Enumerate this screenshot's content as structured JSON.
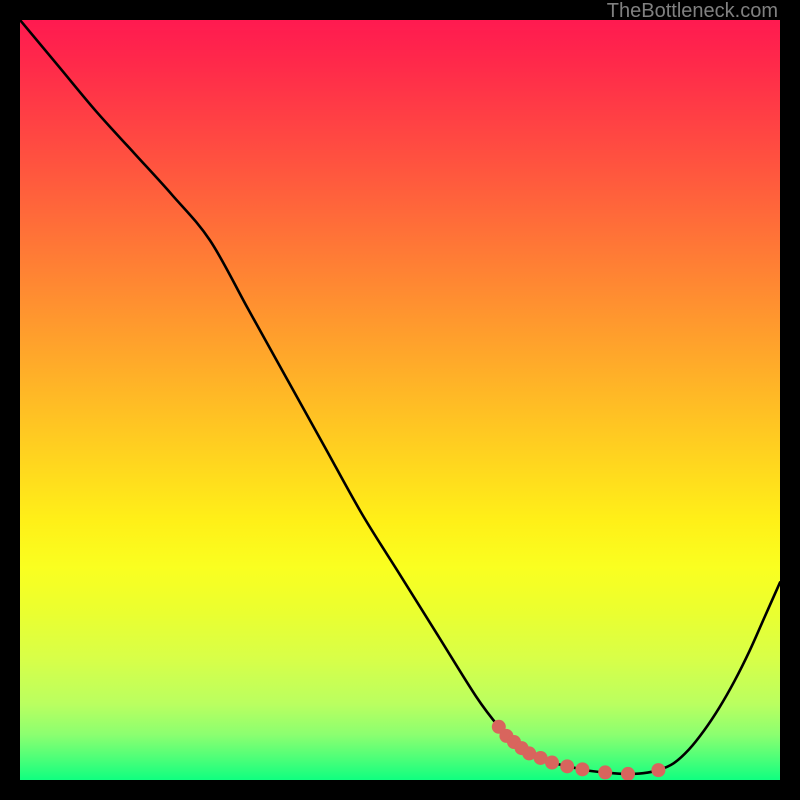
{
  "watermark": "TheBottleneck.com",
  "chart_data": {
    "type": "line",
    "title": "",
    "xlabel": "",
    "ylabel": "",
    "xlim": [
      0,
      100
    ],
    "ylim": [
      0,
      100
    ],
    "grid": false,
    "series": [
      {
        "name": "curve",
        "x": [
          0,
          5,
          10,
          15,
          20,
          25,
          30,
          35,
          40,
          45,
          50,
          55,
          60,
          63,
          65,
          67,
          70,
          73,
          75,
          78,
          80,
          82,
          84,
          86,
          88,
          90,
          92,
          94,
          96,
          98,
          100
        ],
        "y": [
          100,
          94,
          88,
          82.5,
          77,
          71,
          62,
          53,
          44,
          35,
          27,
          19,
          11,
          7,
          5,
          3.5,
          2.3,
          1.6,
          1.2,
          0.9,
          0.8,
          0.9,
          1.3,
          2.2,
          4.0,
          6.5,
          9.5,
          13,
          17,
          21.5,
          26
        ]
      }
    ],
    "markers": {
      "name": "highlight-dots",
      "color": "#d8655d",
      "points": [
        {
          "x": 63,
          "y": 7.0
        },
        {
          "x": 64,
          "y": 5.8
        },
        {
          "x": 65,
          "y": 5.0
        },
        {
          "x": 66,
          "y": 4.2
        },
        {
          "x": 67,
          "y": 3.5
        },
        {
          "x": 68.5,
          "y": 2.9
        },
        {
          "x": 70,
          "y": 2.3
        },
        {
          "x": 72,
          "y": 1.8
        },
        {
          "x": 74,
          "y": 1.4
        },
        {
          "x": 77,
          "y": 1.0
        },
        {
          "x": 80,
          "y": 0.8
        },
        {
          "x": 84,
          "y": 1.3
        }
      ]
    },
    "gradient_stops": [
      {
        "offset": 0.0,
        "color": "#ff1a50"
      },
      {
        "offset": 0.06,
        "color": "#ff2a4a"
      },
      {
        "offset": 0.12,
        "color": "#ff3d45"
      },
      {
        "offset": 0.18,
        "color": "#ff5040"
      },
      {
        "offset": 0.24,
        "color": "#ff643b"
      },
      {
        "offset": 0.3,
        "color": "#ff7836"
      },
      {
        "offset": 0.36,
        "color": "#ff8c31"
      },
      {
        "offset": 0.42,
        "color": "#ffa02c"
      },
      {
        "offset": 0.48,
        "color": "#ffb427"
      },
      {
        "offset": 0.54,
        "color": "#ffc822"
      },
      {
        "offset": 0.6,
        "color": "#ffdc1d"
      },
      {
        "offset": 0.66,
        "color": "#fff018"
      },
      {
        "offset": 0.72,
        "color": "#faff20"
      },
      {
        "offset": 0.78,
        "color": "#eaff30"
      },
      {
        "offset": 0.84,
        "color": "#d8ff48"
      },
      {
        "offset": 0.9,
        "color": "#baff60"
      },
      {
        "offset": 0.94,
        "color": "#8cff70"
      },
      {
        "offset": 0.97,
        "color": "#50ff78"
      },
      {
        "offset": 1.0,
        "color": "#10ff80"
      }
    ]
  }
}
